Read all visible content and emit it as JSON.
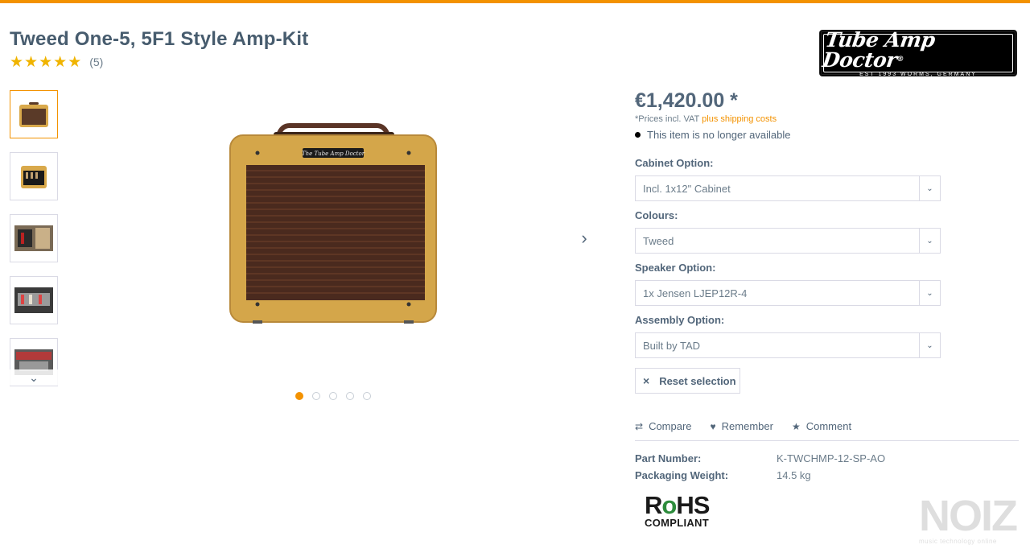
{
  "product": {
    "title": "Tweed One-5, 5F1 Style Amp-Kit",
    "rating_count": "(5)",
    "stars": 5
  },
  "brand_logo": {
    "main": "Tube Amp Doctor",
    "sub": "EST 1993  WORMS, GERMANY",
    "registered": "®"
  },
  "gallery": {
    "slide_count": 5,
    "active_index": 0,
    "amp_badge_text": "The Tube Amp Doctor",
    "next_icon": "chevron-right-icon",
    "down_icon": "chevron-down-icon"
  },
  "buybox": {
    "price": "€1,420.00 *",
    "vat_text": "*Prices incl. VAT",
    "shipping_link": "plus shipping costs",
    "availability": "This item is no longer available"
  },
  "options": [
    {
      "label": "Cabinet Option:",
      "value": "Incl. 1x12\" Cabinet"
    },
    {
      "label": "Colours:",
      "value": "Tweed"
    },
    {
      "label": "Speaker Option:",
      "value": "1x Jensen LJEP12R-4"
    },
    {
      "label": "Assembly Option:",
      "value": "Built by TAD"
    }
  ],
  "reset": {
    "icon": "×",
    "label": "Reset selection"
  },
  "actions": [
    {
      "icon": "⇄",
      "label": "Compare"
    },
    {
      "icon": "♥",
      "label": "Remember"
    },
    {
      "icon": "★",
      "label": "Comment"
    }
  ],
  "properties": [
    {
      "label": "Part Number:",
      "value": "K-TWCHMP-12-SP-AO"
    },
    {
      "label": "Packaging Weight:",
      "value": "14.5 kg"
    }
  ],
  "rohs": {
    "r": "R",
    "o": "o",
    "hs": "HS",
    "compliant": "COMPLIANT"
  },
  "watermark": {
    "text": "NOIZ",
    "sub": "music technology online"
  },
  "colors": {
    "accent": "#f39200",
    "text": "#52667a",
    "star": "#f0b400"
  }
}
